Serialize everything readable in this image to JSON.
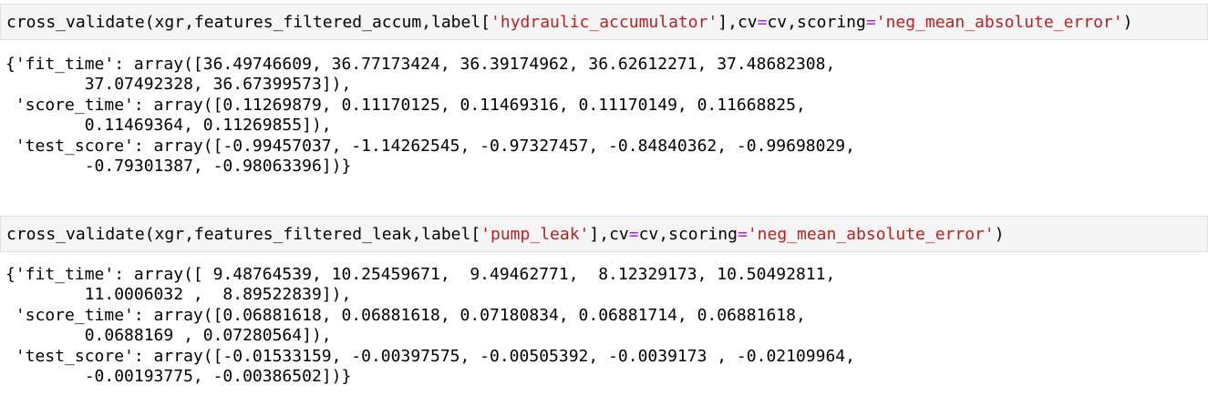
{
  "cells": [
    {
      "input": {
        "tokens": [
          {
            "t": "cross_validate(xgr,features_filtered_accum,label[",
            "k": "plain"
          },
          {
            "t": "'hydraulic_accumulator'",
            "k": "str"
          },
          {
            "t": "],cv",
            "k": "plain"
          },
          {
            "t": "=",
            "k": "op"
          },
          {
            "t": "cv,scoring",
            "k": "plain"
          },
          {
            "t": "=",
            "k": "op"
          },
          {
            "t": "'neg_mean_absolute_error'",
            "k": "str"
          },
          {
            "t": ")",
            "k": "plain"
          }
        ]
      },
      "output": [
        "{'fit_time': array([36.49746609, 36.77173424, 36.39174962, 36.62612271, 37.48682308,",
        "        37.07492328, 36.67399573]),",
        " 'score_time': array([0.11269879, 0.11170125, 0.11469316, 0.11170149, 0.11668825,",
        "        0.11469364, 0.11269855]),",
        " 'test_score': array([-0.99457037, -1.14262545, -0.97327457, -0.84840362, -0.99698029,",
        "        -0.79301387, -0.98063396])}"
      ]
    },
    {
      "input": {
        "tokens": [
          {
            "t": "cross_validate(xgr,features_filtered_leak,label[",
            "k": "plain"
          },
          {
            "t": "'pump_leak'",
            "k": "str"
          },
          {
            "t": "],cv",
            "k": "plain"
          },
          {
            "t": "=",
            "k": "op"
          },
          {
            "t": "cv,scoring",
            "k": "plain"
          },
          {
            "t": "=",
            "k": "op"
          },
          {
            "t": "'neg_mean_absolute_error'",
            "k": "str"
          },
          {
            "t": ")",
            "k": "plain"
          }
        ]
      },
      "output": [
        "{'fit_time': array([ 9.48764539, 10.25459671,  9.49462771,  8.12329173, 10.50492811,",
        "        11.0006032 ,  8.89522839]),",
        " 'score_time': array([0.06881618, 0.06881618, 0.07180834, 0.06881714, 0.06881618,",
        "        0.0688169 , 0.07280564]),",
        " 'test_score': array([-0.01533159, -0.00397575, -0.00505392, -0.0039173 , -0.02109964,",
        "        -0.00193775, -0.00386502])}"
      ]
    }
  ]
}
